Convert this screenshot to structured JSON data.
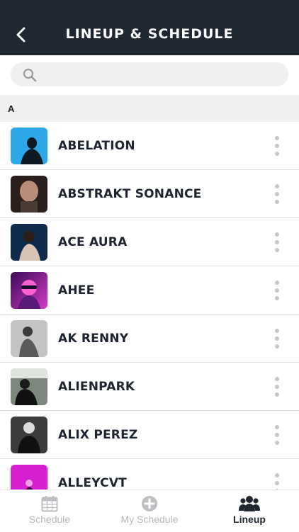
{
  "header": {
    "title": "LINEUP & SCHEDULE"
  },
  "search": {
    "placeholder": "",
    "value": ""
  },
  "section": {
    "letter": "A"
  },
  "artists": [
    {
      "name": "ABELATION",
      "thumb_bg": "#2ea7e8",
      "thumb_accent": "#0d1a24"
    },
    {
      "name": "ABSTRAKT SONANCE",
      "thumb_bg": "#2a1f1d",
      "thumb_accent": "#c9a08c"
    },
    {
      "name": "ACE AURA",
      "thumb_bg": "#0f2a4a",
      "thumb_accent": "#d8c4b4"
    },
    {
      "name": "AHEE",
      "thumb_bg": "#7a1d8c",
      "thumb_accent": "#ff5fd0"
    },
    {
      "name": "AK RENNY",
      "thumb_bg": "#bcbcbc",
      "thumb_accent": "#3b3b3b"
    },
    {
      "name": "ALIENPARK",
      "thumb_bg": "#6f7a6f",
      "thumb_accent": "#111111"
    },
    {
      "name": "ALIX PEREZ",
      "thumb_bg": "#3c3c3c",
      "thumb_accent": "#111111"
    },
    {
      "name": "ALLEYCVT",
      "thumb_bg": "#d61fd0",
      "thumb_accent": "#f2a0e8"
    }
  ],
  "tabs": [
    {
      "label": "Schedule",
      "icon": "calendar-icon",
      "active": false
    },
    {
      "label": "My Schedule",
      "icon": "plus-circle-icon",
      "active": false
    },
    {
      "label": "Lineup",
      "icon": "people-icon",
      "active": true
    }
  ],
  "colors": {
    "header_bg": "#1f2731",
    "active_tab": "#1f2731",
    "inactive_tab": "#b8b8bc"
  }
}
